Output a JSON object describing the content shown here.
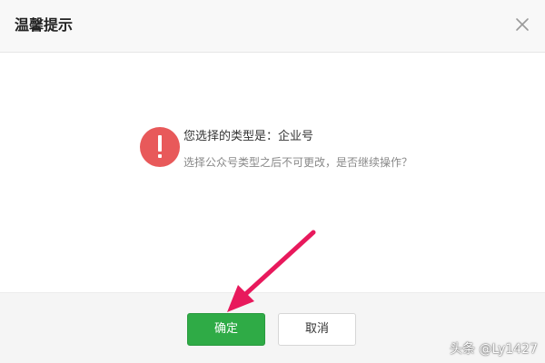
{
  "dialog": {
    "title": "温馨提示",
    "close_icon": "close-x-icon",
    "warning_icon": "exclamation-circle-icon",
    "message_main": "您选择的类型是：企业号",
    "message_sub": "选择公众号类型之后不可更改，是否继续操作？",
    "confirm_label": "确定",
    "cancel_label": "取消"
  },
  "colors": {
    "warning": "#e8595a",
    "confirm": "#2fab46",
    "arrow": "#e8195c"
  },
  "watermark": {
    "text": "头条 @Ly1427"
  }
}
